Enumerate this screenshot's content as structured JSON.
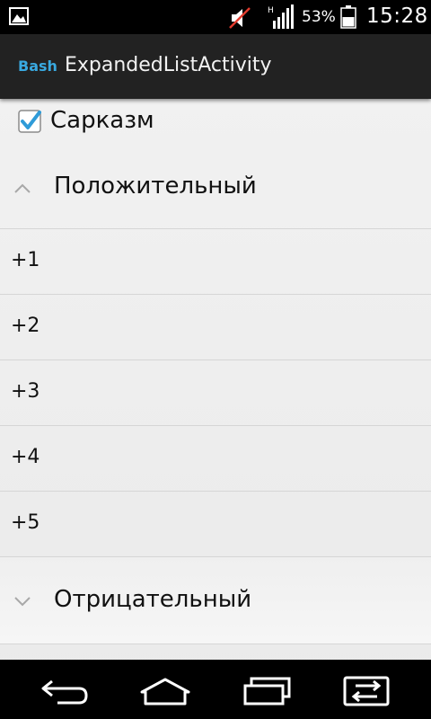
{
  "status_bar": {
    "icons": [
      "gallery-icon",
      "mute-icon",
      "signal-icon",
      "battery-icon"
    ],
    "network_letter": "H",
    "battery_percent": "53%",
    "time": "15:28"
  },
  "action_bar": {
    "app_icon_text": "Bash",
    "title": "ExpandedListActivity",
    "accent_color": "#39a9e0"
  },
  "checkbox": {
    "label": "Сарказм",
    "checked": true
  },
  "groups": [
    {
      "label": "Положительный",
      "expanded": true,
      "children": [
        "+1",
        "+2",
        "+3",
        "+4",
        "+5"
      ]
    },
    {
      "label": "Отрицательный",
      "expanded": false,
      "children": []
    }
  ],
  "nav_bar": {
    "buttons": [
      "back-icon",
      "home-icon",
      "recent-apps-icon",
      "switch-app-icon"
    ]
  }
}
